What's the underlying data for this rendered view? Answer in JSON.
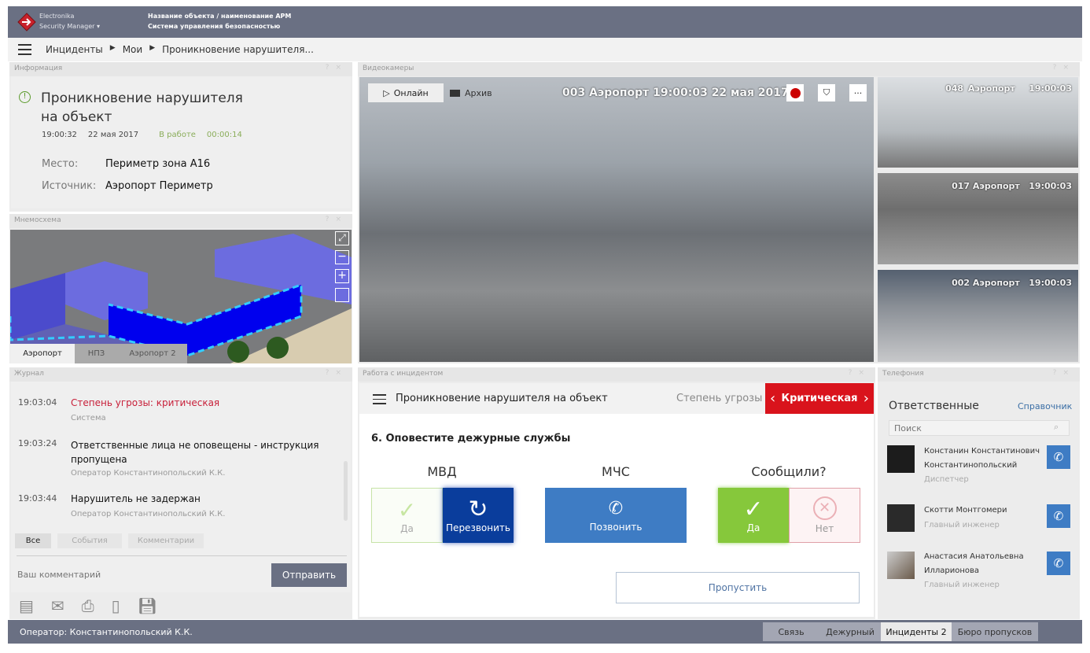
{
  "header": {
    "brand_line1": "Electronika",
    "brand_line2": "Security Manager",
    "object_name": "Название объекта / наименование АРМ",
    "system_name": "Система управления безопасностью"
  },
  "breadcrumb": [
    "Инциденты",
    "Мои",
    "Проникновение нарушителя..."
  ],
  "info": {
    "panel_title": "Информация",
    "title_line1": "Проникновение нарушителя",
    "title_line2": "на объект",
    "time": "19:00:32",
    "date": "22 мая 2017",
    "status": "В работе",
    "elapsed": "00:00:14",
    "place_label": "Место:",
    "place": "Периметр зона А16",
    "source_label": "Источник:",
    "source": "Аэропорт Периметр"
  },
  "mnemo": {
    "panel_title": "Мнемосхема",
    "tabs": [
      "Аэропорт",
      "НПЗ",
      "Аэропорт 2"
    ],
    "active_tab": 0
  },
  "video": {
    "panel_title": "Видеокамеры",
    "online": "Онлайн",
    "archive": "Архив",
    "main_label": "003 Аэропорт 19:00:03 22 мая 2017",
    "more": "···",
    "side": [
      {
        "name": "048 Аэропорт",
        "time": "19:00:03"
      },
      {
        "name": "017 Аэропорт",
        "time": "19:00:03"
      },
      {
        "name": "002 Аэропорт",
        "time": "19:00:03"
      }
    ]
  },
  "journal": {
    "panel_title": "Журнал",
    "entries": [
      {
        "time": "19:03:04",
        "text": "Степень угрозы: критическая",
        "author": "Система",
        "critical": true
      },
      {
        "time": "19:03:24",
        "text": "Ответственные лица не оповещены - инструкция пропущена",
        "author": "Оператор Константинопольский К.К."
      },
      {
        "time": "19:03:44",
        "text": "Нарушитель не задержан",
        "author": "Оператор Константинопольский К.К."
      }
    ],
    "filters": [
      "Все",
      "События",
      "Комментарии"
    ],
    "comment_placeholder": "Ваш комментарий",
    "send": "Отправить"
  },
  "incident": {
    "panel_title": "Работа с инцидентом",
    "title": "Проникновение нарушителя на объект",
    "threat_label": "Степень угрозы",
    "threat_value": "Критическая",
    "threat_color": "#d9131c",
    "step": "6. Оповестите дежурные службы",
    "mvd": {
      "title": "МВД",
      "yes": "Да",
      "recall": "Перезвонить"
    },
    "mchs": {
      "title": "МЧС",
      "call": "Позвонить"
    },
    "reported": {
      "title": "Сообщили?",
      "yes": "Да",
      "no": "Нет"
    },
    "skip": "Пропустить"
  },
  "telephony": {
    "panel_title": "Телефония",
    "title": "Ответственные",
    "directory": "Справочник",
    "search_placeholder": "Поиск",
    "contacts": [
      {
        "name1": "Констанин Константинович",
        "name2": "Константинопольский",
        "role": "Диспетчер"
      },
      {
        "name1": "Скотти Монтгомери",
        "name2": "",
        "role": "Главный инженер"
      },
      {
        "name1": "Анастасия Анатольевна",
        "name2": "Илларионова",
        "role": "Главный инженер"
      }
    ]
  },
  "status": {
    "operator": "Оператор: Константинопольский К.К.",
    "tabs": [
      "Связь",
      "Дежурный",
      "Инциденты 2",
      "Бюро пропусков"
    ],
    "active_tab": 2
  }
}
